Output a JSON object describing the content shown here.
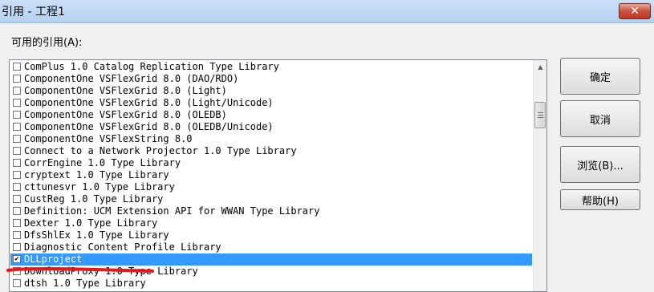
{
  "window": {
    "title": "引用 - 工程1",
    "close_icon": "✕"
  },
  "available_label": "可用的引用(A):",
  "references": [
    {
      "label": "ComPlus 1.0 Catalog Replication Type Library",
      "checked": false
    },
    {
      "label": "ComponentOne VSFlexGrid 8.0 (DAO/RDO)",
      "checked": false
    },
    {
      "label": "ComponentOne VSFlexGrid 8.0 (Light)",
      "checked": false
    },
    {
      "label": "ComponentOne VSFlexGrid 8.0 (Light/Unicode)",
      "checked": false
    },
    {
      "label": "ComponentOne VSFlexGrid 8.0 (OLEDB)",
      "checked": false
    },
    {
      "label": "ComponentOne VSFlexGrid 8.0 (OLEDB/Unicode)",
      "checked": false
    },
    {
      "label": "ComponentOne VSFlexString 8.0",
      "checked": false
    },
    {
      "label": "Connect to a Network Projector 1.0 Type Library",
      "checked": false
    },
    {
      "label": "CorrEngine 1.0 Type Library",
      "checked": false
    },
    {
      "label": "cryptext 1.0 Type Library",
      "checked": false
    },
    {
      "label": "cttunesvr 1.0 Type Library",
      "checked": false
    },
    {
      "label": "CustReg 1.0 Type Library",
      "checked": false
    },
    {
      "label": "Definition: UCM Extension API for WWAN Type Library",
      "checked": false
    },
    {
      "label": "Dexter 1.0 Type Library",
      "checked": false
    },
    {
      "label": "DfsShlEx 1.0 Type Library",
      "checked": false
    },
    {
      "label": "Diagnostic Content Profile Library",
      "checked": false
    },
    {
      "label": "DLLproject",
      "checked": true,
      "selected": true
    },
    {
      "label": "DownloadProxy 1.0 Type Library",
      "checked": false
    },
    {
      "label": "dtsh 1.0 Type Library",
      "checked": false
    }
  ],
  "buttons": {
    "ok": "确定",
    "cancel": "取消",
    "browse": "浏览(B)...",
    "help": "帮助(H)"
  },
  "colors": {
    "selection": "#3399ff",
    "annotation_stroke": "#e8171b"
  }
}
